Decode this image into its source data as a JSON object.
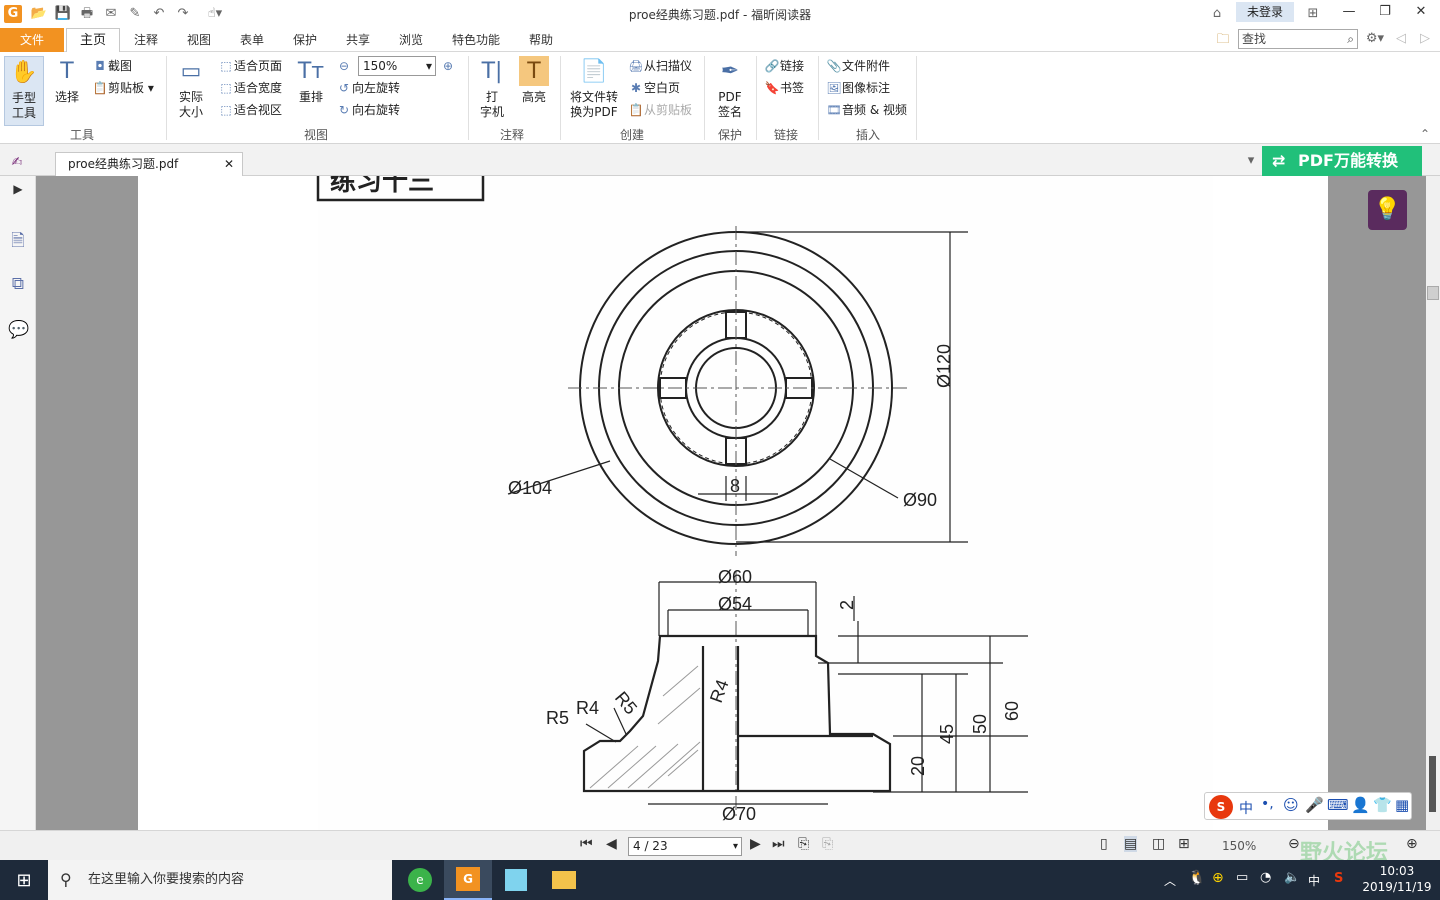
{
  "window": {
    "title": "proe经典练习题.pdf - 福昕阅读器",
    "login_label": "未登录"
  },
  "menu": {
    "file": "文件",
    "tabs": [
      "主页",
      "注释",
      "视图",
      "表单",
      "保护",
      "共享",
      "浏览",
      "特色功能",
      "帮助"
    ],
    "search_placeholder": "查找"
  },
  "ribbon": {
    "tools": {
      "label": "工具",
      "hand": "手型\n工具",
      "select": "选择",
      "snapshot": "截图",
      "clipboard": "剪贴板"
    },
    "view": {
      "label": "视图",
      "actual_size": "实际\n大小",
      "fit_page": "适合页面",
      "fit_width": "适合宽度",
      "fit_visible": "适合视区",
      "reflow": "重排",
      "zoom": "150%",
      "rotate_left": "向左旋转",
      "rotate_right": "向右旋转"
    },
    "comment": {
      "label": "注释",
      "typewriter": "打\n字机",
      "highlight": "高亮"
    },
    "create": {
      "label": "创建",
      "convert": "将文件转\n换为PDF",
      "from_scanner": "从扫描仪",
      "blank_page": "空白页",
      "from_clipboard": "从剪贴板"
    },
    "protect": {
      "label": "保护",
      "pdf_sign": "PDF\n签名"
    },
    "links": {
      "label": "链接",
      "link": "链接",
      "bookmark": "书签"
    },
    "insert": {
      "label": "插入",
      "file_attachment": "文件附件",
      "image_annotation": "图像标注",
      "audio_video": "音频 & 视频"
    }
  },
  "document_tab": {
    "name": "proe经典练习题.pdf",
    "pdf_convert": "PDF万能转换"
  },
  "drawing": {
    "header_text": "练习十三",
    "top_view_dims": [
      "Ø120",
      "Ø104",
      "Ø90",
      "8"
    ],
    "front_view_dims": [
      "Ø60",
      "Ø54",
      "2",
      "R4",
      "R4",
      "R5",
      "R5",
      "45",
      "50",
      "60",
      "20",
      "Ø70"
    ]
  },
  "status": {
    "page": "4 / 23",
    "zoom": "150%"
  },
  "taskbar": {
    "search_placeholder": "在这里输入你要搜索的内容",
    "ime_lang": "中",
    "time": "10:03",
    "date": "2019/11/19",
    "watermark": "野火论坛"
  },
  "ime_toolbar": {
    "lang": "中"
  }
}
